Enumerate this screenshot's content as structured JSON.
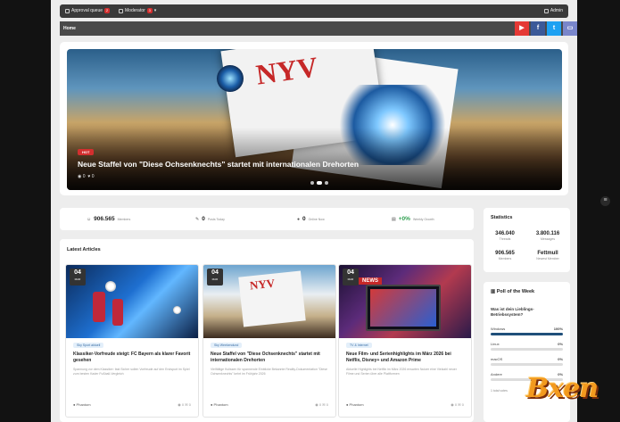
{
  "topbar": {
    "approval_label": "Approval queue",
    "approval_count": "2",
    "moderator_label": "Moderator",
    "moderator_count": "3",
    "admin_label": "Admin"
  },
  "nav": {
    "home": "Home",
    "social": [
      {
        "name": "youtube",
        "glyph": "▶",
        "color": "#e53935"
      },
      {
        "name": "facebook",
        "glyph": "f",
        "color": "#3b5998"
      },
      {
        "name": "twitter",
        "glyph": "t",
        "color": "#1da1f2"
      },
      {
        "name": "tv",
        "glyph": "▭",
        "color": "#7986cb"
      }
    ]
  },
  "hero": {
    "badge": "HOT",
    "title": "Neue Staffel von \"Diese Ochsenknechts\" startet mit internationalen Drehorten",
    "views": "0",
    "likes": "0",
    "slide_index": 2,
    "slide_count": 3
  },
  "stats_row": [
    {
      "value": "906.565",
      "label": "Members"
    },
    {
      "value": "0",
      "label": "Posts Today"
    },
    {
      "value": "0",
      "label": "Online Now"
    },
    {
      "value": "+0%",
      "label": "Weekly Growth"
    }
  ],
  "statistics": {
    "title": "Statistics",
    "items": [
      {
        "value": "346.040",
        "label": "Threads"
      },
      {
        "value": "3.800.116",
        "label": "Messages"
      },
      {
        "value": "906.565",
        "label": "Members"
      },
      {
        "value": "Fettmull",
        "label": "Newest Member"
      }
    ]
  },
  "poll": {
    "title": "Poll of the Week",
    "question": "Was ist dein Lieblings-Betriebssystem?",
    "options": [
      {
        "label": "Windows",
        "pct": "100%",
        "value": 1.0
      },
      {
        "label": "Linux",
        "pct": "0%",
        "value": 0
      },
      {
        "label": "macOS",
        "pct": "0%",
        "value": 0
      },
      {
        "label": "Andere",
        "pct": "0%",
        "value": 0
      }
    ],
    "total": "1 total votes"
  },
  "latest": {
    "title": "Latest Articles",
    "articles": [
      {
        "day": "04",
        "month": "MAR",
        "category": "Sky Sport aktuell",
        "title": "Klassiker-Vorfreude steigt: FC Bayern als klarer Favorit gesehen",
        "excerpt": "Spannung vor dem Klassiker: fast Sicher sollen Vorfreude auf den Endspurt im Spiel zum besten Kader Fußball-Vergleich",
        "author": "Phantom",
        "views": "0",
        "comments": "0"
      },
      {
        "day": "04",
        "month": "MAR",
        "category": "Sky Weekendund",
        "title": "Neue Staffel von \"Diese Ochsenknechts\" startet mit internationalen Drehorten",
        "excerpt": "Vielfältige Kulissen für spannende Einblicke Bekannte Reality-Dokumentation \"Diese Ochsenknechts\" kehrt im Frühjahr 2026",
        "author": "Phantom",
        "views": "0",
        "comments": "0"
      },
      {
        "day": "04",
        "month": "MAR",
        "category": "TV & Internet",
        "title": "Neue Film- und Serienhighlights im März 2026 bei Netflix, Disney+ und Amazon Prime",
        "excerpt": "Aktuelle Highlights bei Netflix im März 2026 erwarten Nutzer eine Vielzahl neuer Filme und Serien über alle Plattformen",
        "author": "Phantom",
        "views": "0",
        "comments": "0"
      }
    ]
  },
  "brand": "Bxen"
}
